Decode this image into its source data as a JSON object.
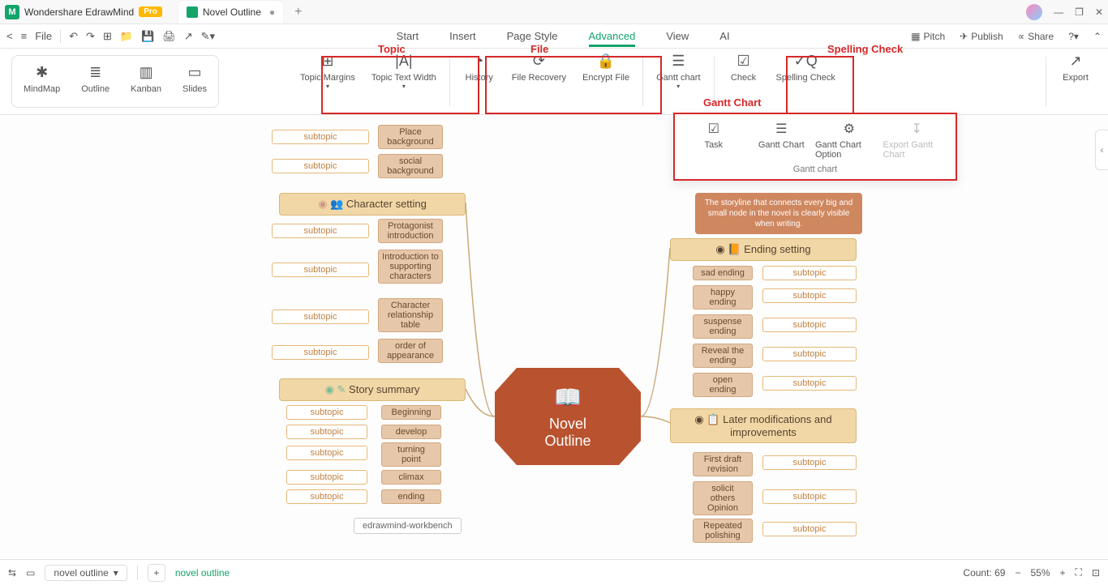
{
  "app": {
    "name": "Wondershare EdrawMind",
    "pro": "Pro"
  },
  "doc": {
    "title": "Novel Outline"
  },
  "menu": {
    "start": "Start",
    "insert": "Insert",
    "pageStyle": "Page Style",
    "advanced": "Advanced",
    "view": "View",
    "ai": "AI"
  },
  "rightmenu": {
    "pitch": "Pitch",
    "publish": "Publish",
    "share": "Share"
  },
  "views": {
    "mindmap": "MindMap",
    "outline": "Outline",
    "kanban": "Kanban",
    "slides": "Slides"
  },
  "ribbon": {
    "topicMargins": "Topic Margins",
    "topicTextWidth": "Topic Text Width",
    "history": "History",
    "fileRecovery": "File Recovery",
    "encryptFile": "Encrypt File",
    "ganttChart": "Gantt chart",
    "check": "Check",
    "spellingCheck": "Spelling Check",
    "export": "Export"
  },
  "gantt": {
    "task": "Task",
    "chart": "Gantt Chart",
    "option": "Gantt Chart Option",
    "export": "Export Gantt Chart",
    "caption": "Gantt chart"
  },
  "annotations": {
    "topic": "Topic",
    "file": "File",
    "spelling": "Spelling Check",
    "gantt": "Gantt Chart"
  },
  "mindmap": {
    "central1": "Novel",
    "central2": "Outline",
    "characterSetting": "Character setting",
    "storySummary": "Story summary",
    "endingSetting": "Ending setting",
    "laterMods": "Later modifications and improvements",
    "subtopic": "subtopic",
    "placeBg": "Place background",
    "socialBg": "social background",
    "protagonist": "Protagonist introduction",
    "supporting": "Introduction to supporting characters",
    "relationship": "Character relationship table",
    "appearance": "order of appearance",
    "beginning": "Beginning",
    "develop": "develop",
    "turning": "turning point",
    "climax": "climax",
    "ending": "ending",
    "sad": "sad ending",
    "happy": "happy ending",
    "suspense": "suspense ending",
    "reveal": "Reveal the ending",
    "open": "open ending",
    "firstDraft": "First draft revision",
    "solicit": "solicit others Opinion",
    "repeated": "Repeated polishing",
    "note": "The storyline that connects every big and small node in the novel is clearly visible when writing.",
    "workbench": "edrawmind-workbench"
  },
  "status": {
    "fileName": "novel outline",
    "breadcrumb": "novel outline",
    "count": "Count: 69",
    "zoom": "55%"
  },
  "file": "File"
}
